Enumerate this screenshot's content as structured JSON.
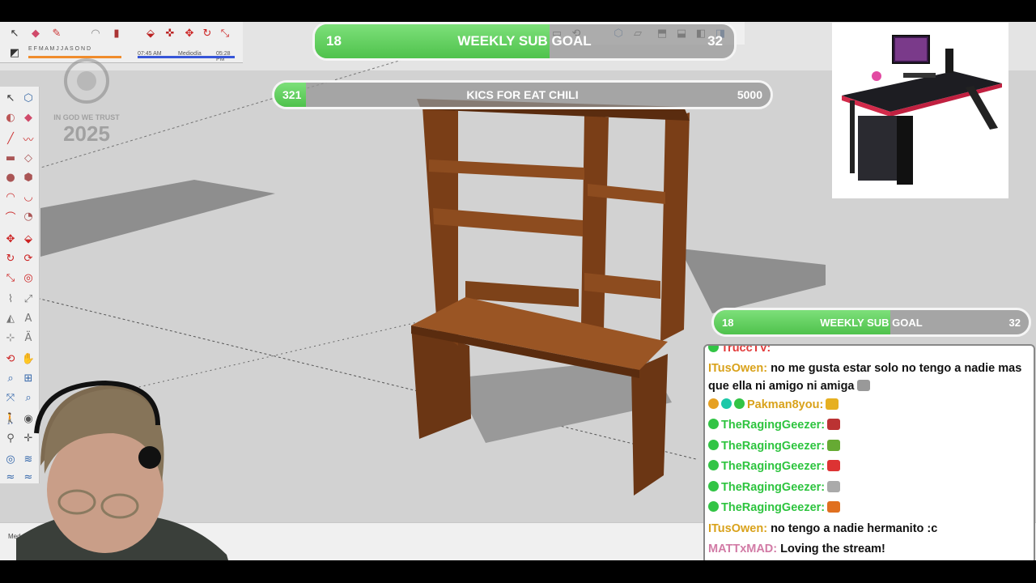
{
  "app": {
    "status_left": "Med"
  },
  "overlay": {
    "top_goal": {
      "label": "WEEKLY SUB GOAL",
      "current": "18",
      "target": "32",
      "progress": 0.56
    },
    "kics_goal": {
      "label": "KICS FOR EAT CHILI",
      "current": "321",
      "target": "5000",
      "progress": 0.064
    },
    "side_goal": {
      "label": "WEEKLY SUB GOAL",
      "current": "18",
      "target": "32",
      "progress": 0.56
    },
    "watermark": {
      "line1": "IN GOD WE TRUST",
      "year": "2025"
    }
  },
  "toolbar": {
    "time_left": "07:45 AM",
    "mid_label": "Mediodía",
    "time_right": "05:28 PM",
    "letters": "E F M A M J J A S O N D"
  },
  "chat": {
    "messages": [
      {
        "user": "TruccTV:",
        "text": "",
        "user_color": "#e23c3c",
        "badge": true
      },
      {
        "user": "ITusOwen:",
        "text": "no me gusta estar solo no tengo a nadie mas que ella ni amigo ni amiga",
        "user_color": "#d9a21b",
        "badge": false
      },
      {
        "user": "Pakman8you:",
        "text": "",
        "user_color": "#d9a21b",
        "badge": true
      },
      {
        "user": "TheRagingGeezer:",
        "text": "",
        "user_color": "#2ec43f",
        "badge": true
      },
      {
        "user": "TheRagingGeezer:",
        "text": "",
        "user_color": "#2ec43f",
        "badge": true
      },
      {
        "user": "TheRagingGeezer:",
        "text": "",
        "user_color": "#2ec43f",
        "badge": true
      },
      {
        "user": "TheRagingGeezer:",
        "text": "",
        "user_color": "#2ec43f",
        "badge": true
      },
      {
        "user": "TheRagingGeezer:",
        "text": "",
        "user_color": "#2ec43f",
        "badge": true
      },
      {
        "user": "ITusOwen:",
        "text": "no tengo a nadie hermanito :c",
        "user_color": "#d9a21b",
        "badge": false
      },
      {
        "user": "MATTxMAD:",
        "text": "Loving the stream!",
        "user_color": "#d27ba6",
        "badge": false
      }
    ]
  },
  "colors": {
    "goal_green": "#5ccf58",
    "wood": "#8a4b1f",
    "viewport_bg": "#d2d2d2"
  }
}
